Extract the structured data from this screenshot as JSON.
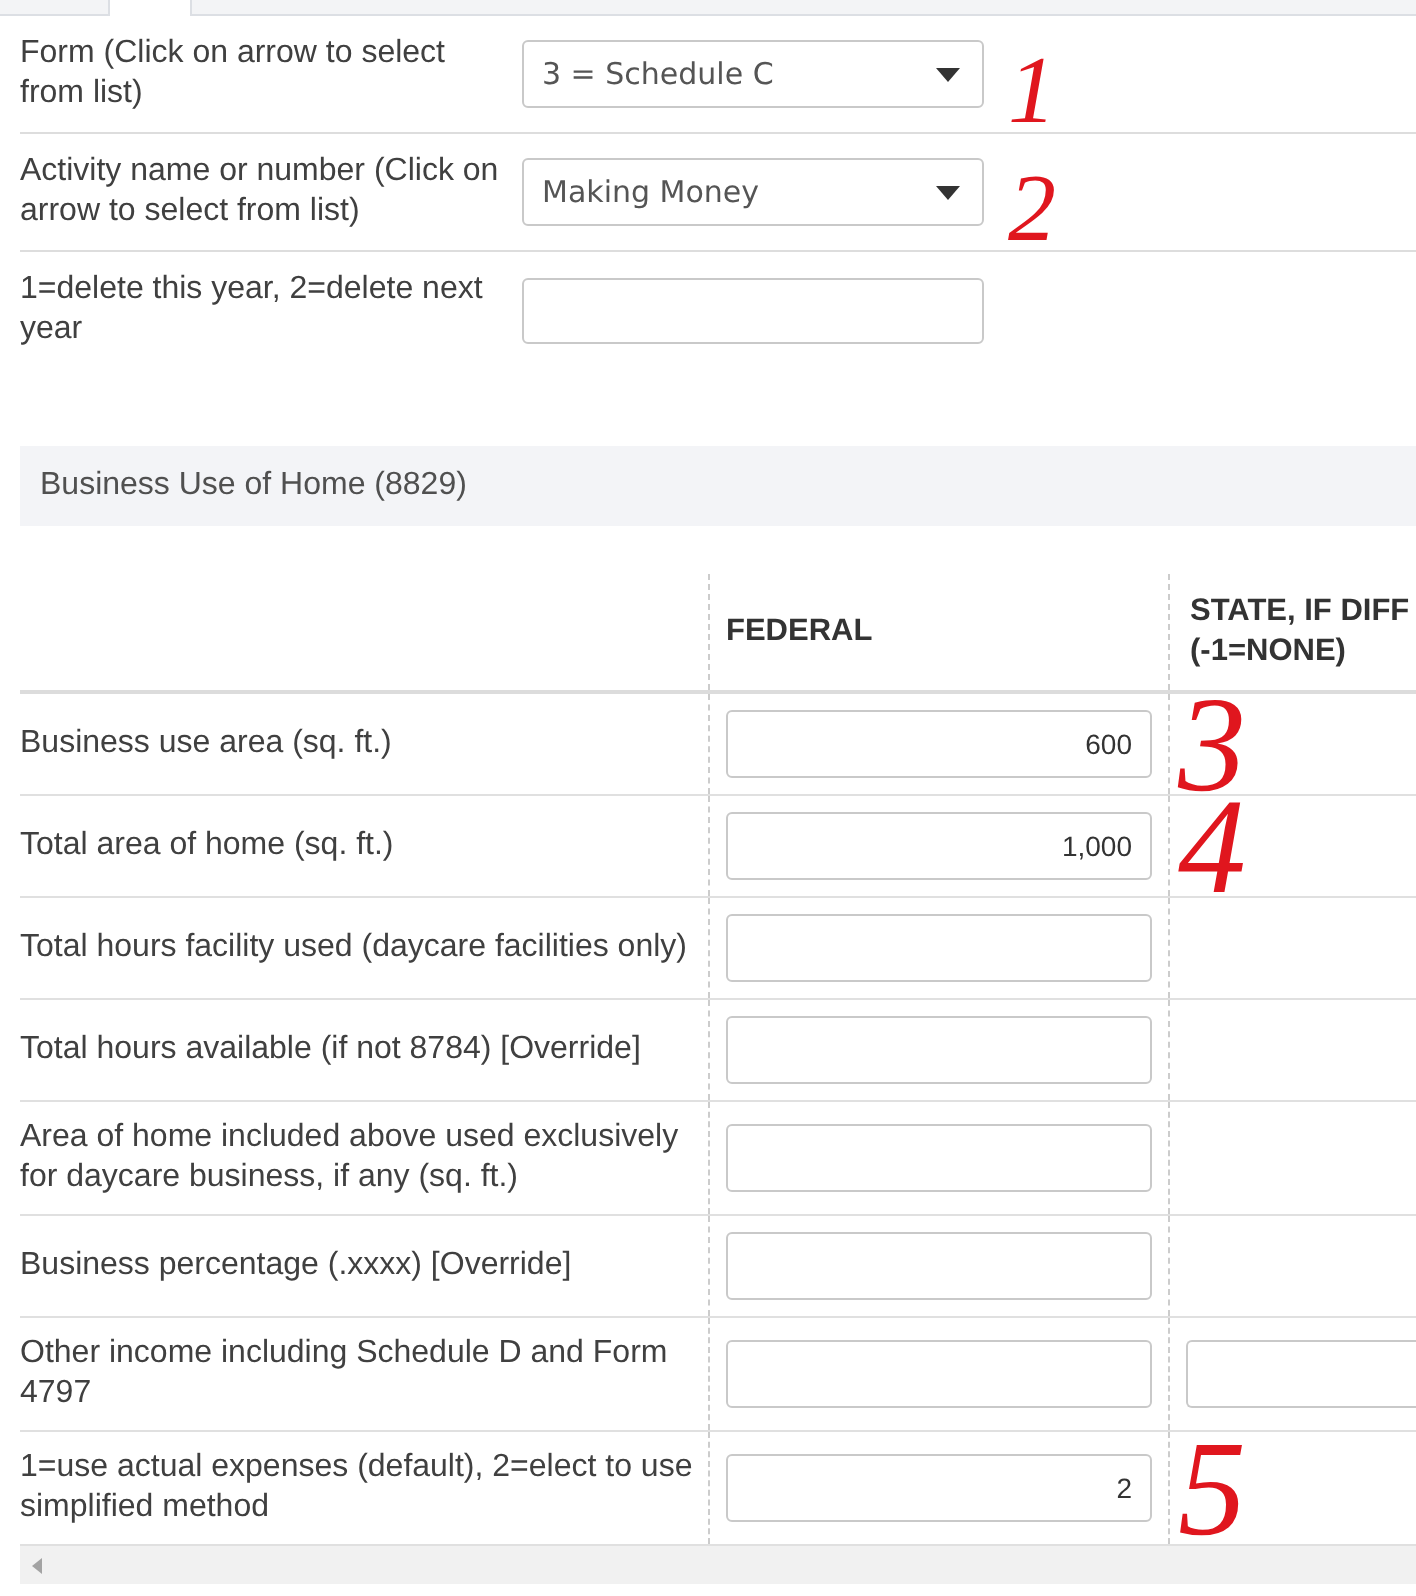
{
  "form_fields": [
    {
      "kind": "dropdown",
      "label": "Form (Click on arrow to select from list)",
      "value": "3 = Schedule C",
      "annotation": "1"
    },
    {
      "kind": "dropdown",
      "label": "Activity name or number (Click on arrow to select from list)",
      "value": "Making Money",
      "annotation": "2"
    },
    {
      "kind": "text",
      "label": "1=delete this year, 2=delete next year"
    }
  ],
  "section": {
    "title": "Business Use of Home (8829)"
  },
  "table": {
    "columns": [
      {
        "heading": "FEDERAL"
      },
      {
        "heading": "STATE, IF DIFF (-1=NONE)"
      }
    ],
    "rows": [
      {
        "label": "Business use area (sq. ft.)",
        "federal": "600",
        "state_field": false,
        "annotation": "3"
      },
      {
        "label": "Total area of home (sq. ft.)",
        "federal": "1,000",
        "state_field": false,
        "annotation": "4"
      },
      {
        "label": "Total hours facility used (daycare facilities only)",
        "state_field": false
      },
      {
        "label": "Total hours available (if not 8784) [Override]",
        "state_field": false
      },
      {
        "label": "Area of home included above used exclusively for daycare business, if any (sq. ft.)",
        "state_field": false
      },
      {
        "label": "Business percentage (.xxxx) [Override]",
        "state_field": false
      },
      {
        "label": "Other income including Schedule D and Form 4797",
        "state_field": true
      },
      {
        "label": "1=use actual expenses (default), 2=elect to use simplified method",
        "federal": "2",
        "state_field": false,
        "annotation": "5"
      }
    ]
  }
}
